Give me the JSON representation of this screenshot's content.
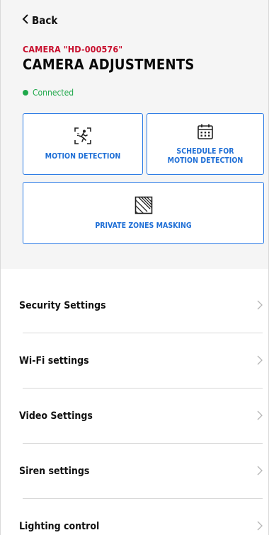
{
  "header": {
    "back_label": "Back",
    "camera_label": "CAMERA \"HD-000576\"",
    "title": "CAMERA ADJUSTMENTS",
    "status": "Connected"
  },
  "tiles": {
    "motion": "MOTION DETECTION",
    "schedule_line1": "SCHEDULE FOR",
    "schedule_line2": "MOTION DETECTION",
    "masking": "PRIVATE ZONES MASKING"
  },
  "settings": [
    {
      "label": "Security Settings"
    },
    {
      "label": "Wi-Fi settings"
    },
    {
      "label": "Video Settings"
    },
    {
      "label": "Siren settings"
    },
    {
      "label": "Lighting control"
    }
  ],
  "colors": {
    "accent_blue": "#2c7be5",
    "camera_red": "#c8102e",
    "connected_green": "#1fa84a"
  },
  "icons": {
    "back": "chevron-left-icon",
    "motion": "motion-sensor-icon",
    "schedule": "calendar-icon",
    "masking": "hatched-square-icon",
    "row": "chevron-right-icon"
  }
}
